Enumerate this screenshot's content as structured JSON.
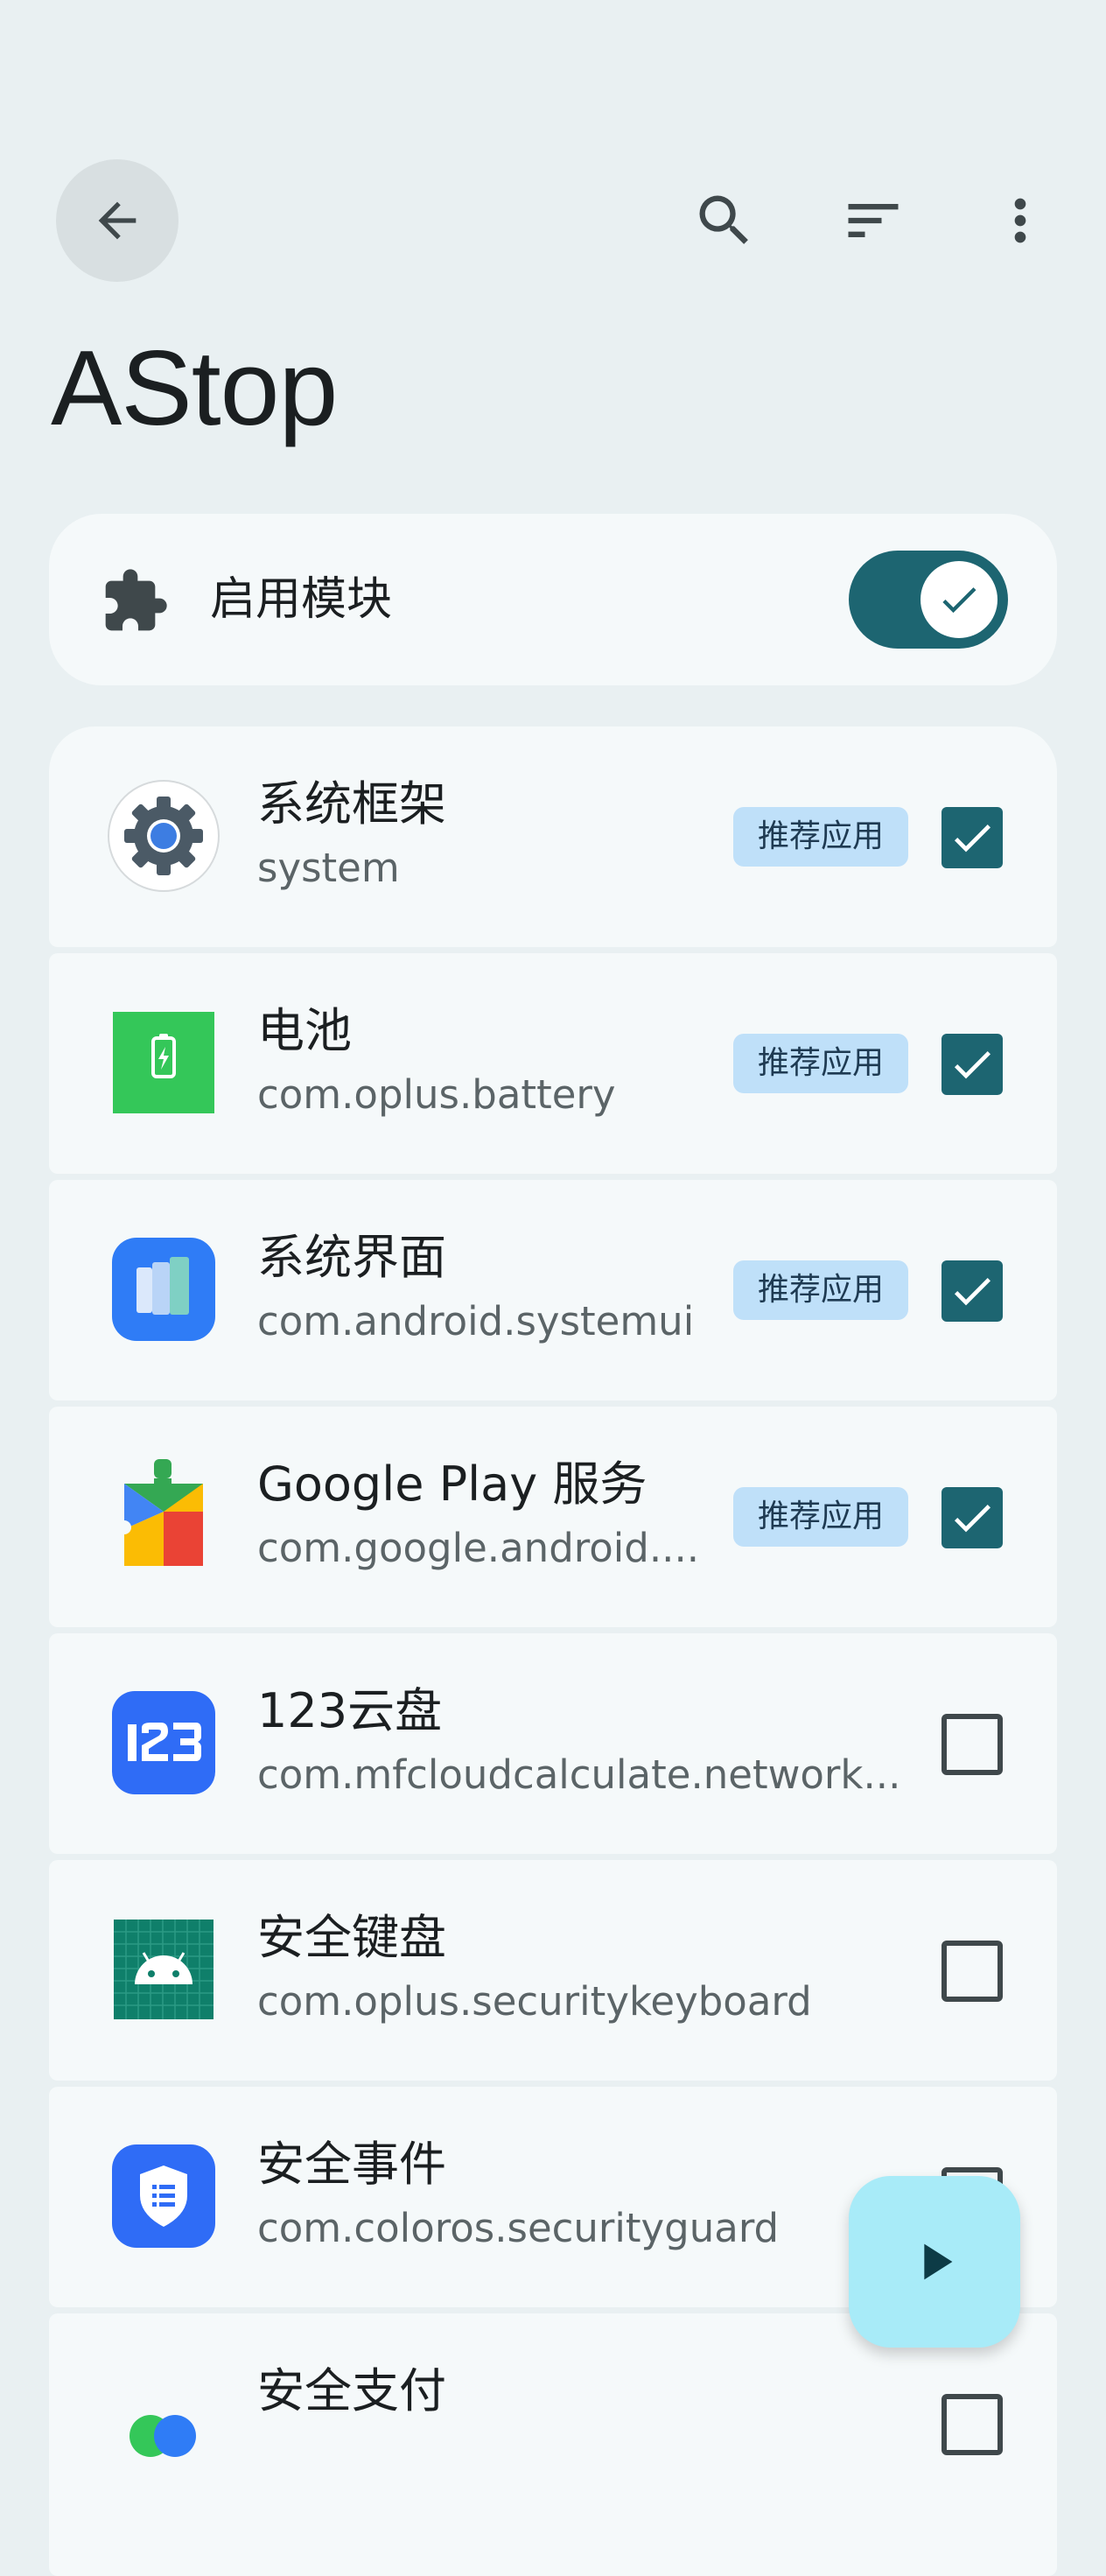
{
  "header": {
    "title": "AStop",
    "back_icon": "arrow-back-icon",
    "search_icon": "search-icon",
    "sort_icon": "sort-icon",
    "more_icon": "more-vert-icon"
  },
  "module": {
    "label": "启用模块",
    "icon": "puzzle-icon",
    "enabled": true
  },
  "apps": [
    {
      "name": "系统框架",
      "package": "system",
      "badge": "推荐应用",
      "checked": true,
      "icon": "settings-gear-icon"
    },
    {
      "name": "电池",
      "package": "com.oplus.battery",
      "badge": "推荐应用",
      "checked": true,
      "icon": "battery-icon"
    },
    {
      "name": "系统界面",
      "package": "com.android.systemui",
      "badge": "推荐应用",
      "checked": true,
      "icon": "systemui-icon"
    },
    {
      "name": "Google Play 服务",
      "package": "com.google.android....",
      "badge": "推荐应用",
      "checked": true,
      "icon": "google-play-services-icon"
    },
    {
      "name": "123云盘",
      "package": "com.mfcloudcalculate.network...",
      "checked": false,
      "icon": "app-123-icon"
    },
    {
      "name": "安全键盘",
      "package": "com.oplus.securitykeyboard",
      "checked": false,
      "icon": "android-robot-icon"
    },
    {
      "name": "安全事件",
      "package": "com.coloros.securityguard",
      "checked": false,
      "icon": "security-shield-icon"
    },
    {
      "name": "安全支付",
      "package": "",
      "checked": false,
      "icon": "secure-pay-icon"
    }
  ],
  "fab": {
    "icon": "play-icon"
  },
  "colors": {
    "background": "#e9f0f2",
    "card": "#f5f9fa",
    "accent": "#1d6571",
    "badge": "#bfe0f9",
    "fab": "#a8ebf8"
  }
}
